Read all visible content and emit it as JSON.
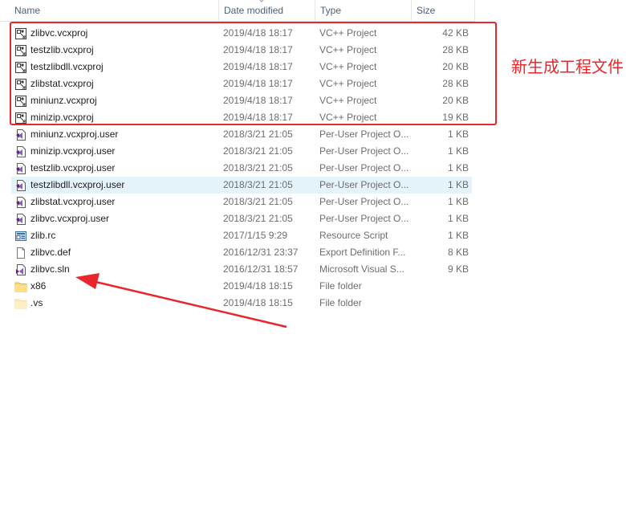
{
  "columns": {
    "name": "Name",
    "date": "Date modified",
    "type": "Type",
    "size": "Size"
  },
  "files": [
    {
      "name": "zlibvc.vcxproj",
      "date": "2019/4/18 18:17",
      "type": "VC++ Project",
      "size": "42 KB",
      "icon": "vcxproj-icon"
    },
    {
      "name": "testzlib.vcxproj",
      "date": "2019/4/18 18:17",
      "type": "VC++ Project",
      "size": "28 KB",
      "icon": "vcxproj-icon"
    },
    {
      "name": "testzlibdll.vcxproj",
      "date": "2019/4/18 18:17",
      "type": "VC++ Project",
      "size": "20 KB",
      "icon": "vcxproj-icon"
    },
    {
      "name": "zlibstat.vcxproj",
      "date": "2019/4/18 18:17",
      "type": "VC++ Project",
      "size": "28 KB",
      "icon": "vcxproj-icon"
    },
    {
      "name": "miniunz.vcxproj",
      "date": "2019/4/18 18:17",
      "type": "VC++ Project",
      "size": "20 KB",
      "icon": "vcxproj-icon"
    },
    {
      "name": "minizip.vcxproj",
      "date": "2019/4/18 18:17",
      "type": "VC++ Project",
      "size": "19 KB",
      "icon": "vcxproj-icon"
    },
    {
      "name": "miniunz.vcxproj.user",
      "date": "2018/3/21 21:05",
      "type": "Per-User Project O...",
      "size": "1 KB",
      "icon": "vs-user-file-icon"
    },
    {
      "name": "minizip.vcxproj.user",
      "date": "2018/3/21 21:05",
      "type": "Per-User Project O...",
      "size": "1 KB",
      "icon": "vs-user-file-icon"
    },
    {
      "name": "testzlib.vcxproj.user",
      "date": "2018/3/21 21:05",
      "type": "Per-User Project O...",
      "size": "1 KB",
      "icon": "vs-user-file-icon"
    },
    {
      "name": "testzlibdll.vcxproj.user",
      "date": "2018/3/21 21:05",
      "type": "Per-User Project O...",
      "size": "1 KB",
      "icon": "vs-user-file-icon",
      "selected": true
    },
    {
      "name": "zlibstat.vcxproj.user",
      "date": "2018/3/21 21:05",
      "type": "Per-User Project O...",
      "size": "1 KB",
      "icon": "vs-user-file-icon"
    },
    {
      "name": "zlibvc.vcxproj.user",
      "date": "2018/3/21 21:05",
      "type": "Per-User Project O...",
      "size": "1 KB",
      "icon": "vs-user-file-icon"
    },
    {
      "name": "zlib.rc",
      "date": "2017/1/15 9:29",
      "type": "Resource Script",
      "size": "1 KB",
      "icon": "resource-script-icon"
    },
    {
      "name": "zlibvc.def",
      "date": "2016/12/31 23:37",
      "type": "Export Definition F...",
      "size": "8 KB",
      "icon": "blank-file-icon"
    },
    {
      "name": "zlibvc.sln",
      "date": "2016/12/31 18:57",
      "type": "Microsoft Visual S...",
      "size": "9 KB",
      "icon": "vs-solution-icon"
    },
    {
      "name": "x86",
      "date": "2019/4/18 18:15",
      "type": "File folder",
      "size": "",
      "icon": "folder-icon"
    },
    {
      "name": ".vs",
      "date": "2019/4/18 18:15",
      "type": "File folder",
      "size": "",
      "icon": "folder-hidden-icon"
    }
  ],
  "annotation": {
    "text": "新生成工程文件"
  },
  "colors": {
    "accent_red": "#e8262b",
    "selection": "#e5f3fb",
    "header_text": "#4c607a"
  }
}
